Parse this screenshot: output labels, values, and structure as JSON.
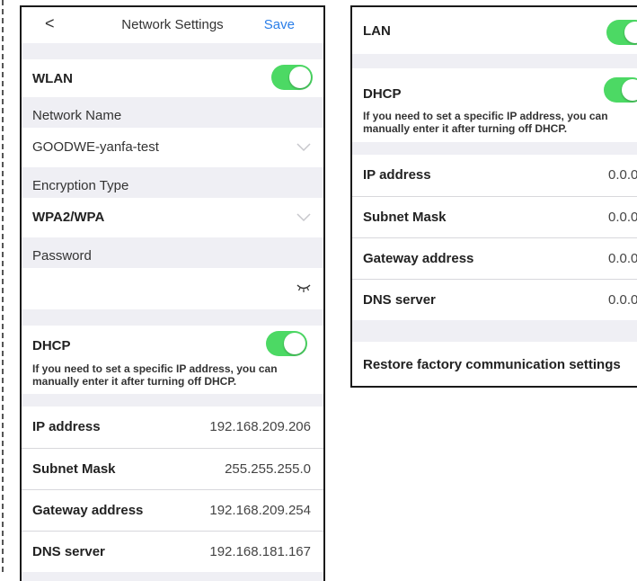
{
  "left": {
    "nav": {
      "back_glyph": "<",
      "title": "Network Settings",
      "save_label": "Save"
    },
    "wlan": {
      "label": "WLAN",
      "enabled": true
    },
    "network_name": {
      "label": "Network Name",
      "value": "GOODWE-yanfa-test"
    },
    "encryption": {
      "label": "Encryption Type",
      "value": "WPA2/WPA"
    },
    "password": {
      "label": "Password",
      "value": "",
      "toggle_icon": "eye-closed-icon"
    },
    "dhcp": {
      "label": "DHCP",
      "enabled": true,
      "hint_line1": "If you need to set a specific IP address, you can",
      "hint_line2": "manually enter it after turning off DHCP."
    },
    "fields": [
      {
        "label": "IP address",
        "value": "192.168.209.206"
      },
      {
        "label": "Subnet Mask",
        "value": "255.255.255.0"
      },
      {
        "label": "Gateway address",
        "value": "192.168.209.254"
      },
      {
        "label": "DNS server",
        "value": "192.168.181.167"
      }
    ]
  },
  "right": {
    "lan": {
      "label": "LAN",
      "enabled": true
    },
    "dhcp": {
      "label": "DHCP",
      "enabled": true,
      "hint_line1": "If you need to set a specific IP address, you can",
      "hint_line2": "manually enter it after turning off DHCP."
    },
    "fields": [
      {
        "label": "IP address",
        "value": "0.0.0"
      },
      {
        "label": "Subnet Mask",
        "value": "0.0.0"
      },
      {
        "label": "Gateway address",
        "value": "0.0.0"
      },
      {
        "label": "DNS server",
        "value": "0.0.0"
      }
    ],
    "restore_label": "Restore factory communication settings"
  },
  "colors": {
    "accent": "#2a7ee8",
    "toggle_on": "#4cd964",
    "section_bg": "#efeff4"
  }
}
